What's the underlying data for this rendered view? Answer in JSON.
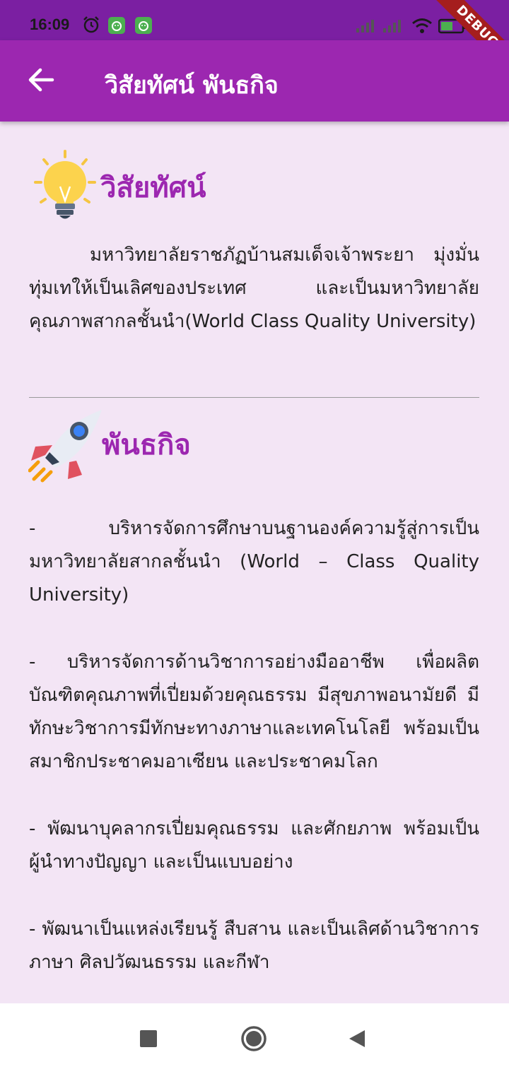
{
  "status_bar": {
    "time": "16:09",
    "battery": "48"
  },
  "debug_banner": "DEBUG",
  "app_bar": {
    "title": "วิสัยทัศน์ พันธกิจ"
  },
  "vision": {
    "title": "วิสัยทัศน์",
    "text": "มหาวิทยาลัยราชภัฏบ้านสมเด็จเจ้าพระยา มุ่งมั่นทุ่มเทให้เป็นเลิศของประเทศ และเป็นมหาวิทยาลัยคุณภาพสากลชั้นนำ(World Class Quality University)"
  },
  "mission": {
    "title": "พันธกิจ",
    "items": [
      "-      บริหารจัดการศึกษาบนฐานองค์ความรู้สู่การเป็นมหาวิทยาลัยสากลชั้นนำ (World – Class Quality University)",
      "- บริหารจัดการด้านวิชาการอย่างมืออาชีพ เพื่อผลิตบัณฑิตคุณภาพที่เปี่ยมด้วยคุณธรรม มีสุขภาพอนามัยดี มีทักษะวิชาการมีทักษะทางภาษาและเทคโนโลยี พร้อมเป็น สมาชิกประชาคมอาเซียน และประชาคมโลก",
      "- พัฒนาบุคลากรเปี่ยมคุณธรรม และศักยภาพ พร้อมเป็นผู้นำทางปัญญา และเป็นแบบอย่าง",
      "- พัฒนาเป็นแหล่งเรียนรู้ สืบสาน และเป็นเลิศด้านวิชาการ ภาษา ศิลปวัฒนธรรม และกีฬา"
    ]
  },
  "colors": {
    "status_bar": "#7b1fa2",
    "app_bar": "#9c27b0",
    "background": "#f3e5f5",
    "accent": "#9c27b0"
  }
}
